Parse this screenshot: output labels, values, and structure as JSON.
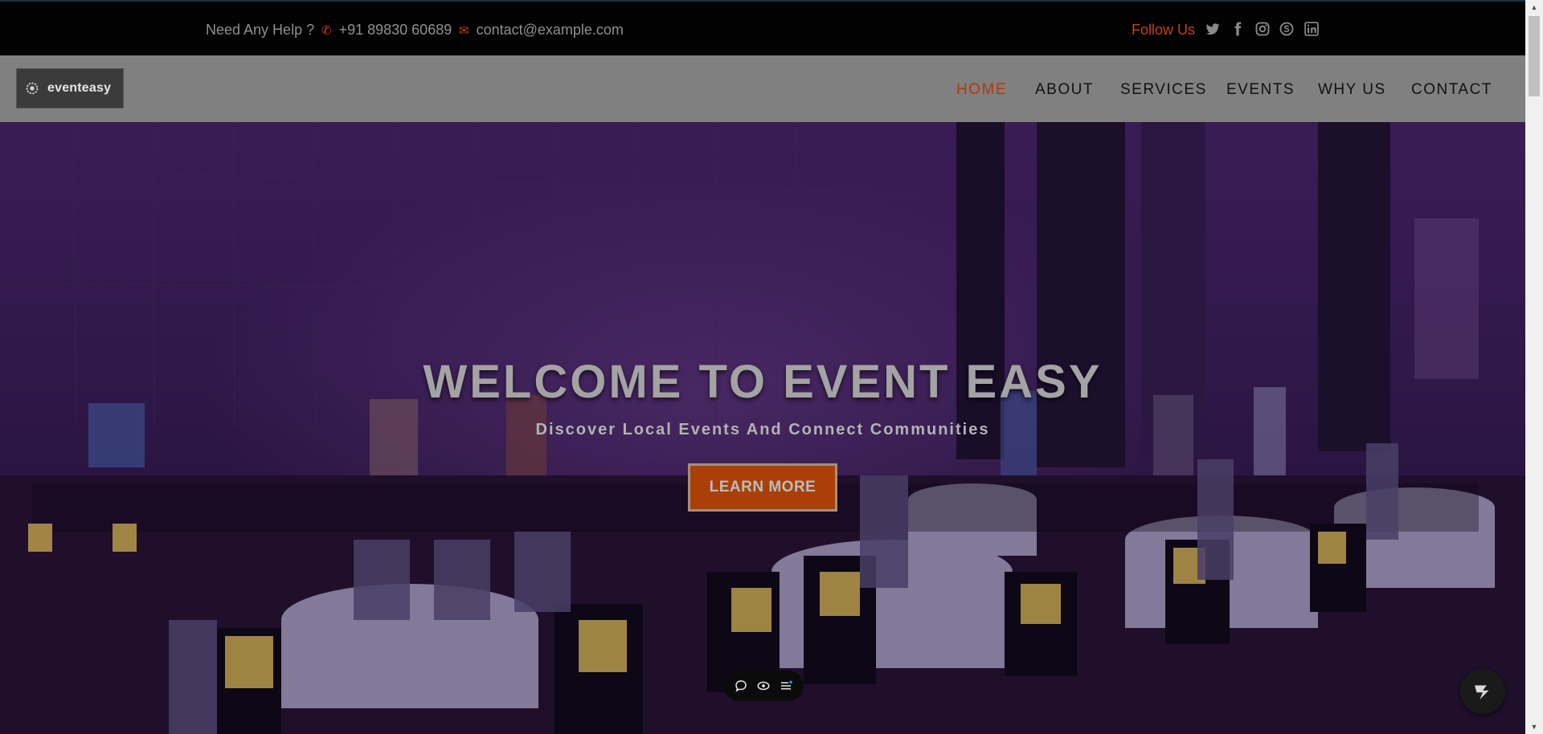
{
  "topbar": {
    "help_text": "Need Any Help ?",
    "phone": "+91 89830 60689",
    "email": "contact@example.com",
    "follow_label": "Follow Us",
    "socials": [
      "twitter-icon",
      "facebook-icon",
      "instagram-icon",
      "skype-icon",
      "linkedin-icon"
    ]
  },
  "brand": {
    "logo_text": "eventeasy"
  },
  "nav": {
    "items": [
      "HOME",
      "ABOUT",
      "SERVICES",
      "EVENTS",
      "WHY US",
      "CONTACT"
    ],
    "active": "HOME"
  },
  "hero": {
    "title": "WELCOME TO EVENT EASY",
    "subtitle": "Discover Local Events And Connect Communities",
    "cta": "LEARN MORE"
  },
  "colors": {
    "accent": "#c2411c",
    "navbar": "#808080",
    "topbar": "#020202"
  }
}
